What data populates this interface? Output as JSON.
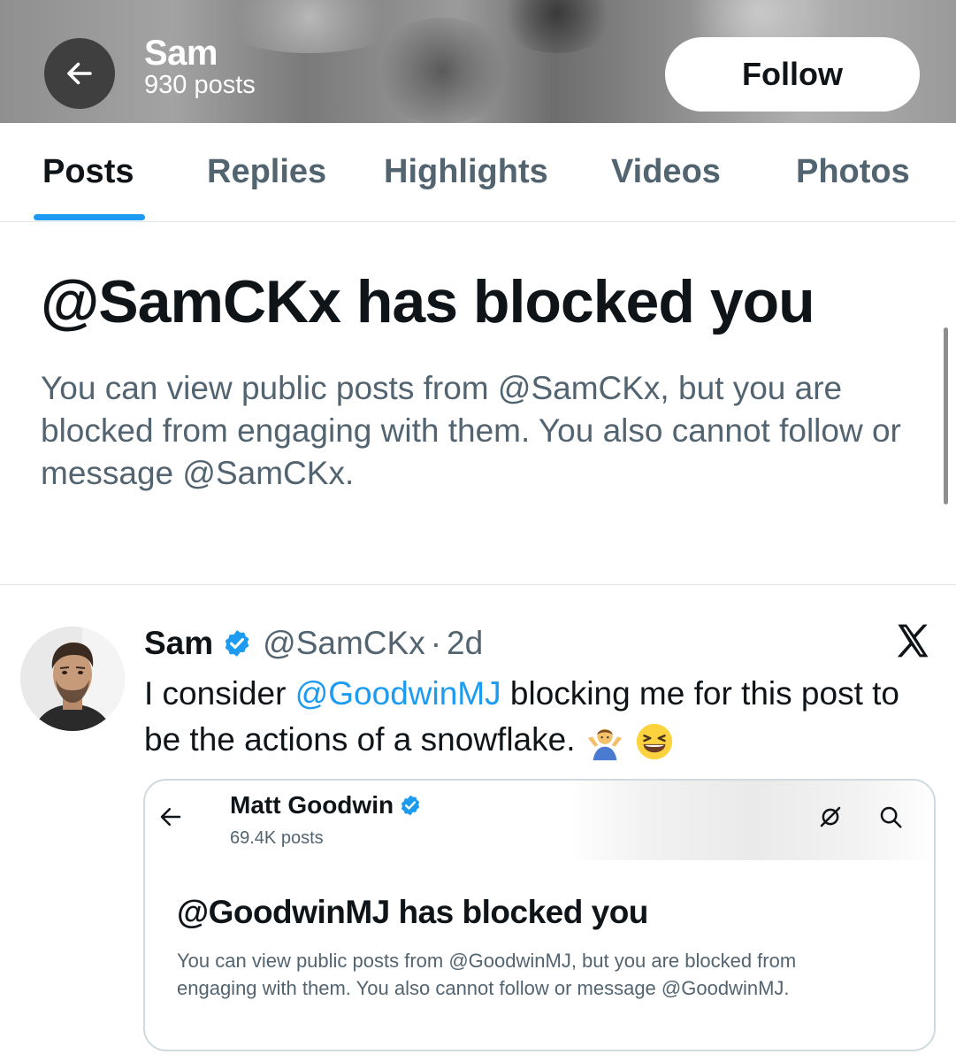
{
  "header": {
    "profile_name": "Sam",
    "post_count": "930 posts",
    "follow_label": "Follow"
  },
  "tabs": [
    {
      "label": "Posts",
      "active": true
    },
    {
      "label": "Replies",
      "active": false
    },
    {
      "label": "Highlights",
      "active": false
    },
    {
      "label": "Videos",
      "active": false
    },
    {
      "label": "Photos",
      "active": false
    }
  ],
  "blocked": {
    "title": "@SamCKx has blocked you",
    "description": "You can view public posts from @SamCKx, but you are blocked from engaging with them. You also cannot follow or message @SamCKx."
  },
  "tweet": {
    "author_name": "Sam",
    "handle": "@SamCKx",
    "separator": "·",
    "time": "2d",
    "text_before": "I consider ",
    "mention": "@GoodwinMJ",
    "text_after": " blocking me for this post to be the actions of a snowflake.",
    "emojis": [
      "man-shrugging-emoji",
      "laughing-squinting-emoji"
    ]
  },
  "embedded_card": {
    "name": "Matt Goodwin",
    "post_count": "69.4K posts",
    "title": "@GoodwinMJ has blocked you",
    "description": "You can view public posts from @GoodwinMJ, but you are blocked from engaging with them. You also cannot follow or message @GoodwinMJ."
  },
  "colors": {
    "accent": "#1d9bf0",
    "text_primary": "#0f1419",
    "text_secondary": "#536471",
    "border": "#cfd9de"
  }
}
